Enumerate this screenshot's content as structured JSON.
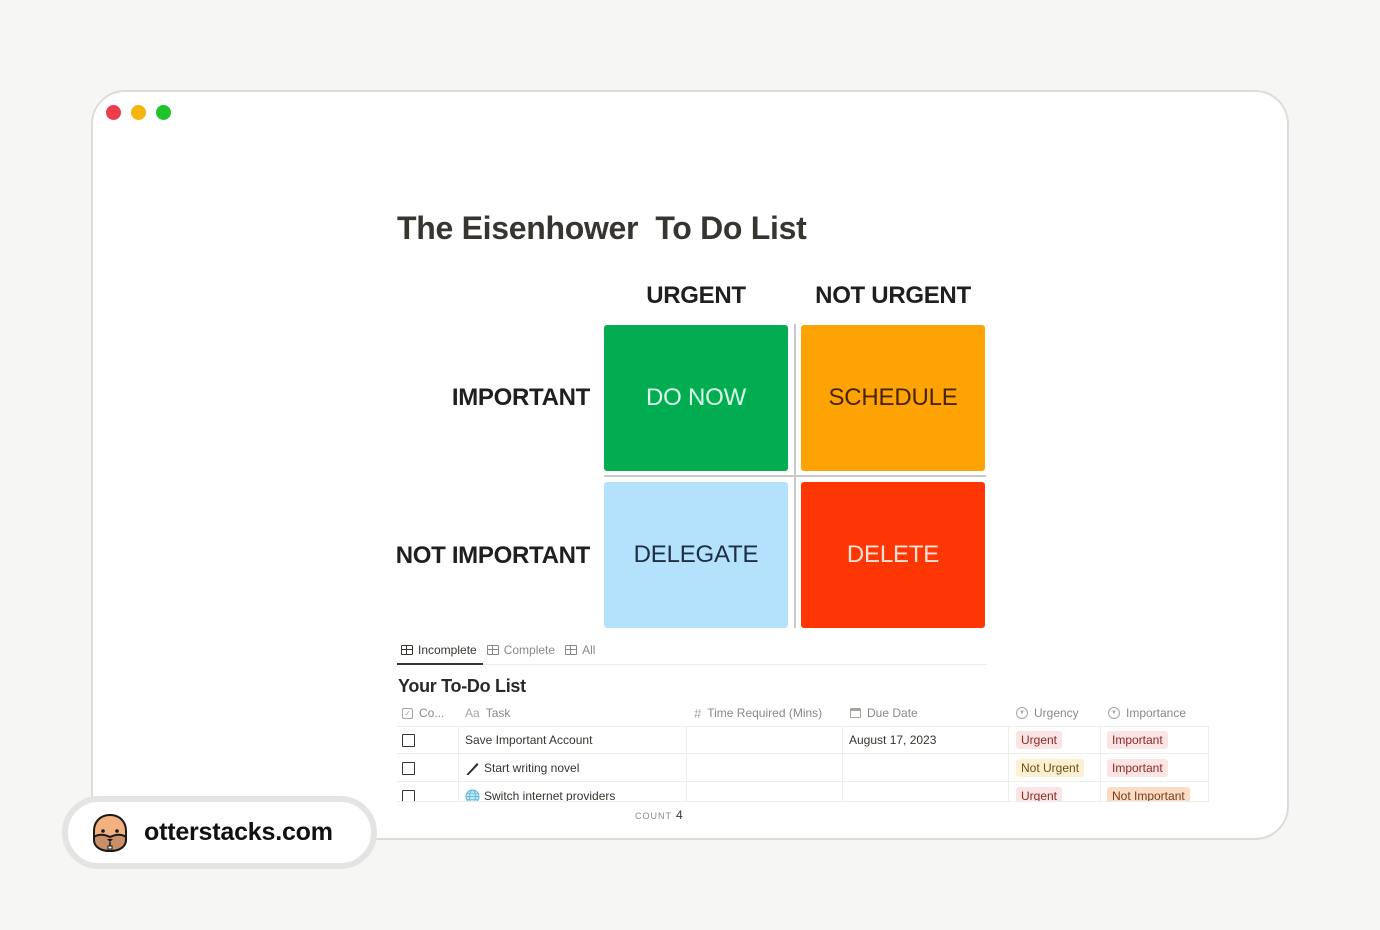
{
  "window": {
    "traffic_lights": [
      {
        "name": "close",
        "color": "#ec3c4e"
      },
      {
        "name": "minimize",
        "color": "#f5b50f"
      },
      {
        "name": "maximize",
        "color": "#1fc42d"
      }
    ]
  },
  "page": {
    "title": "The Eisenhower  To Do List"
  },
  "matrix": {
    "columns": [
      "URGENT",
      "NOT URGENT"
    ],
    "rows": [
      "IMPORTANT",
      "NOT IMPORTANT"
    ],
    "quadrants": [
      {
        "label": "DO NOW",
        "bg": "#02ad52",
        "fg": "#d9fbe8"
      },
      {
        "label": "SCHEDULE",
        "bg": "#fda404",
        "fg": "#4a2408"
      },
      {
        "label": "DELEGATE",
        "bg": "#b4e1fb",
        "fg": "#1c2f44"
      },
      {
        "label": "DELETE",
        "bg": "#fe3604",
        "fg": "#fde3d6"
      }
    ]
  },
  "views": {
    "tabs": [
      {
        "label": "Incomplete",
        "icon": "table-icon",
        "active": true
      },
      {
        "label": "Complete",
        "icon": "table-icon",
        "active": false
      },
      {
        "label": "All",
        "icon": "table-icon",
        "active": false
      }
    ]
  },
  "database": {
    "title": "Your To-Do List",
    "columns": [
      {
        "label": "Co...",
        "icon": "checkbox-prop-icon"
      },
      {
        "label": "Task",
        "icon": "Aa"
      },
      {
        "label": "Time Required (Mins)",
        "icon": "#"
      },
      {
        "label": "Due Date",
        "icon": "calendar-icon"
      },
      {
        "label": "Urgency",
        "icon": "select-icon"
      },
      {
        "label": "Importance",
        "icon": "select-icon"
      }
    ],
    "rows": [
      {
        "complete": false,
        "emoji": "",
        "task": "Save Important Account",
        "time": "",
        "due": "August 17, 2023",
        "urgency": {
          "label": "Urgent",
          "bg": "#fbe4e4",
          "fg": "#8a2a22"
        },
        "importance": {
          "label": "Important",
          "bg": "#fbe4e4",
          "fg": "#8a2a22"
        }
      },
      {
        "complete": false,
        "emoji": "pencil",
        "task": "Start writing novel",
        "time": "",
        "due": "",
        "urgency": {
          "label": "Not Urgent",
          "bg": "#fbf0d1",
          "fg": "#6b4f12"
        },
        "importance": {
          "label": "Important",
          "bg": "#fbe4e4",
          "fg": "#8a2a22"
        }
      },
      {
        "complete": false,
        "emoji": "globe",
        "task": "Switch internet providers",
        "time": "",
        "due": "",
        "urgency": {
          "label": "Urgent",
          "bg": "#fbe4e4",
          "fg": "#8a2a22"
        },
        "importance": {
          "label": "Not Important",
          "bg": "#fbdcc4",
          "fg": "#7a3b14"
        }
      }
    ],
    "count_label": "COUNT",
    "count_value": "4"
  },
  "watermark": {
    "text": "otterstacks.com",
    "icon": "otter-face-icon"
  }
}
